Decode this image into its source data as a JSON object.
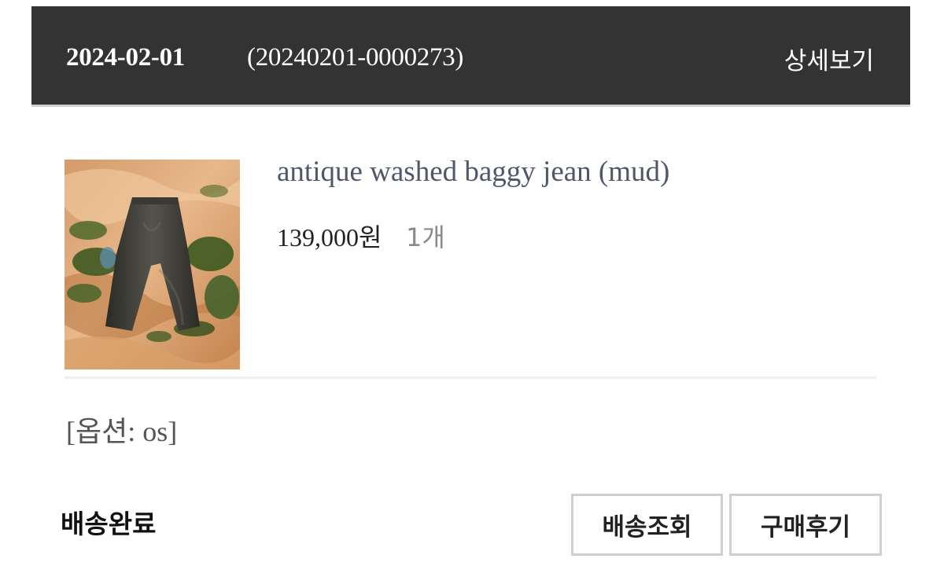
{
  "order": {
    "date": "2024-02-01",
    "number": "(20240201-0000273)",
    "detail_label": "상세보기"
  },
  "product": {
    "name": "antique washed baggy jean (mud)",
    "price": "139,000원",
    "quantity": "1개",
    "option": "[옵션: os]",
    "image_icon": "product-photo-jeans-on-desert"
  },
  "status": "배송완료",
  "actions": {
    "track_label": "배송조회",
    "review_label": "구매후기"
  },
  "colors": {
    "header_bg": "#333333",
    "product_name": "#50576b",
    "button_border": "#cfcfcf"
  }
}
